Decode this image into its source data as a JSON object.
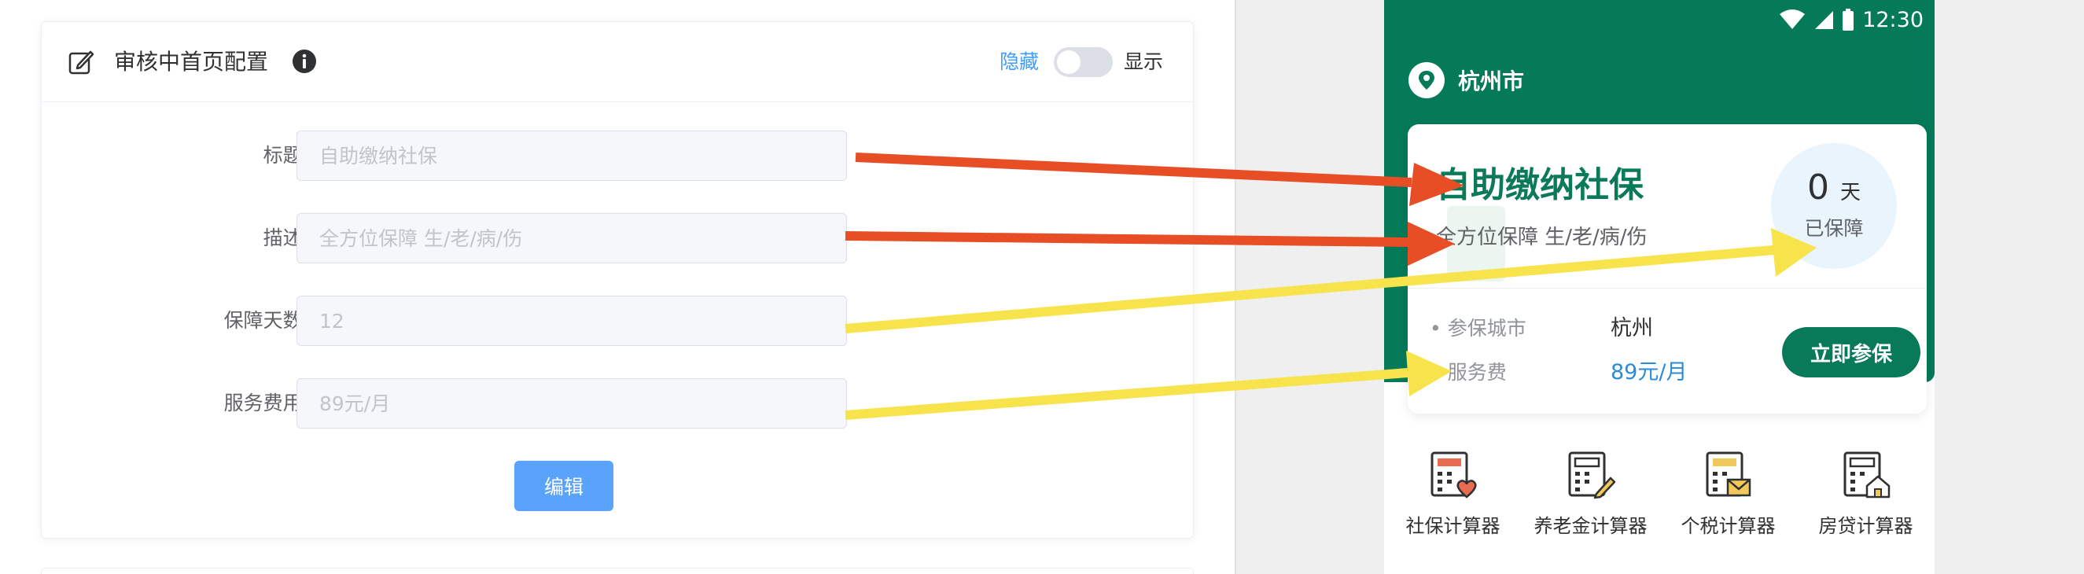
{
  "config_card": {
    "title": "审核中首页配置",
    "toggle_off_label": "隐藏",
    "toggle_on_label": "显示",
    "fields": [
      {
        "label": "标题:",
        "placeholder": "自助缴纳社保"
      },
      {
        "label": "描述:",
        "placeholder": "全方位保障 生/老/病/伤"
      },
      {
        "label": "保障天数:",
        "placeholder": "12"
      },
      {
        "label": "服务费用:",
        "placeholder": "89元/月"
      }
    ],
    "edit_button": "编辑"
  },
  "phone": {
    "status_time": "12:30",
    "city": "杭州市",
    "headline": "自助缴纳社保",
    "subline": "全方位保障 生/老/病/伤",
    "days_number": "0",
    "days_unit": "天",
    "days_label": "已保障",
    "details": [
      {
        "label": "• 参保城市",
        "value": "杭州"
      },
      {
        "label": "• 服务费",
        "value": "89元/月"
      }
    ],
    "join_button": "立即参保",
    "tools": [
      {
        "label": "社保计算器",
        "icon": "calculator-heart-icon"
      },
      {
        "label": "养老金计算器",
        "icon": "calculator-pen-icon"
      },
      {
        "label": "个税计算器",
        "icon": "calculator-envelope-icon"
      },
      {
        "label": "房贷计算器",
        "icon": "calculator-house-icon"
      }
    ]
  },
  "colors": {
    "brand_green": "#047a59",
    "primary_blue": "#5aa3fc",
    "arrow_red": "#e84e26",
    "arrow_yellow": "#f7e34b"
  }
}
